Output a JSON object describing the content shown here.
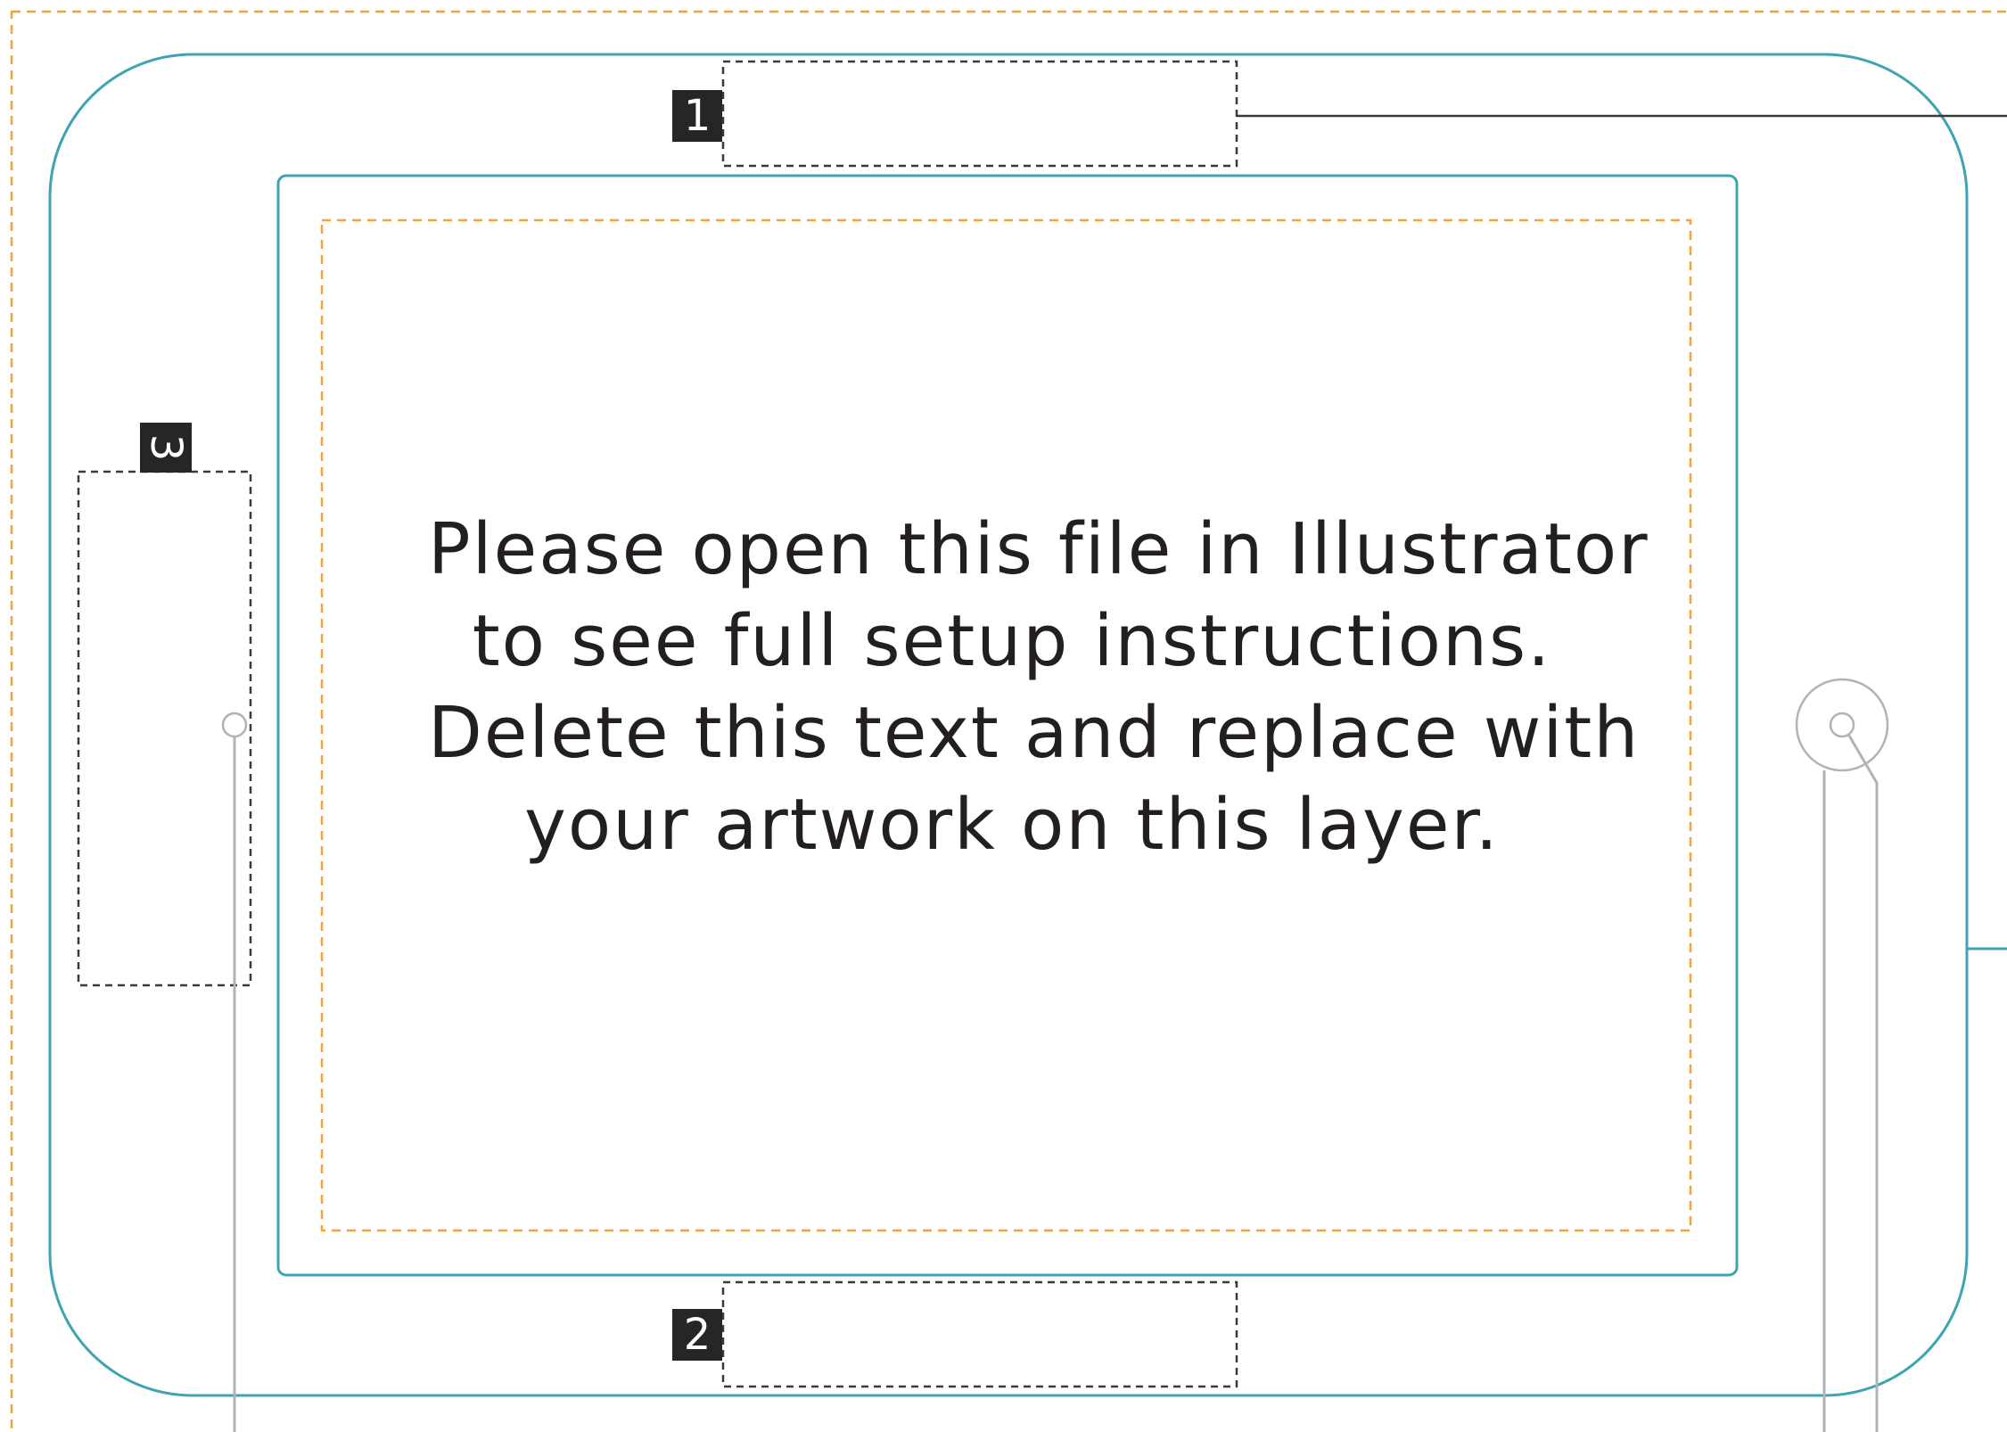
{
  "instructions": {
    "lines": [
      "Please open this file in Illustrator",
      "to see full setup instructions.",
      "Delete this text and replace with",
      "your artwork on this layer."
    ]
  },
  "markers": {
    "top": "1",
    "bottom": "2",
    "left": "3"
  },
  "colors": {
    "device_outline": "#3ea3b2",
    "bleed_guide": "#f0a43a",
    "placement_box": "#3a3a3a",
    "leader_line": "#b3b3b3",
    "marker_fill": "#262626",
    "text": "#231f20"
  }
}
